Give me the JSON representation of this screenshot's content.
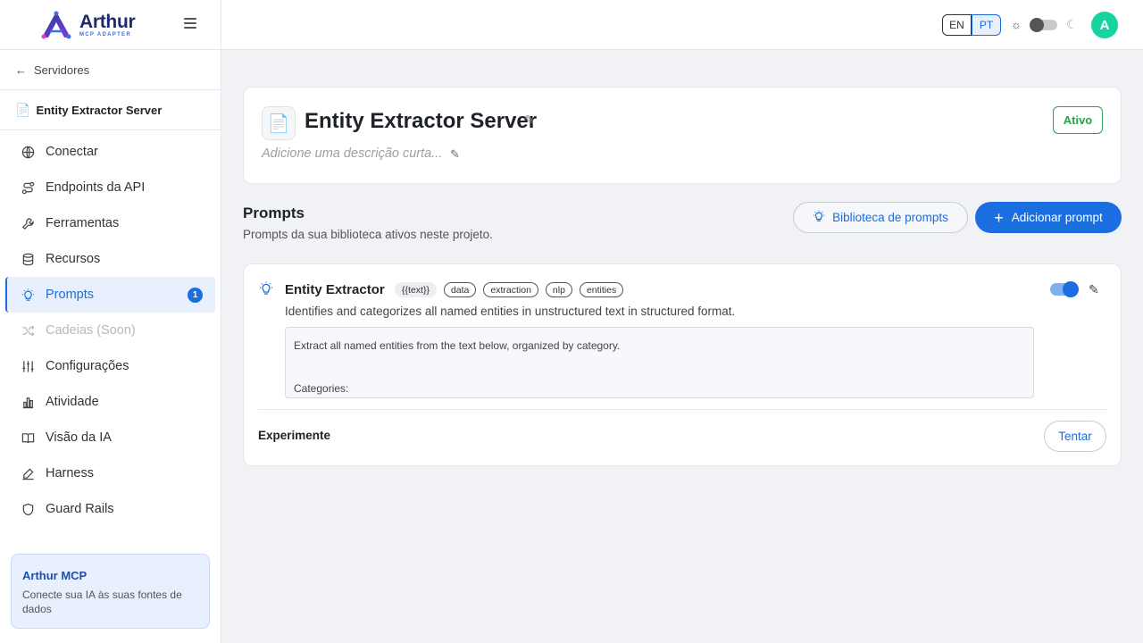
{
  "brand": {
    "title": "Arthur",
    "subtitle": "MCP ADAPTER"
  },
  "sidebar": {
    "back_label": "Servidores",
    "server_name": "Entity Extractor Server",
    "items": [
      {
        "label": "Conectar",
        "icon": "globe-icon"
      },
      {
        "label": "Endpoints da API",
        "icon": "route-icon"
      },
      {
        "label": "Ferramentas",
        "icon": "wrench-icon"
      },
      {
        "label": "Recursos",
        "icon": "database-icon"
      },
      {
        "label": "Prompts",
        "icon": "lightbulb-icon",
        "badge": "1",
        "active": true
      },
      {
        "label": "Cadeias (Soon)",
        "icon": "shuffle-icon",
        "disabled": true
      },
      {
        "label": "Configurações",
        "icon": "sliders-icon"
      },
      {
        "label": "Atividade",
        "icon": "bar-chart-icon"
      },
      {
        "label": "Visão da IA",
        "icon": "book-icon"
      },
      {
        "label": "Harness",
        "icon": "pen-tool-icon"
      },
      {
        "label": "Guard Rails",
        "icon": "shield-icon"
      }
    ],
    "promo": {
      "title": "Arthur MCP",
      "text": "Conecte sua IA às suas fontes de dados"
    }
  },
  "header": {
    "lang_en": "EN",
    "lang_pt": "PT",
    "selected_lang": "PT",
    "avatar_initial": "A",
    "avatar_color": "#16d3a0"
  },
  "server": {
    "title": "Entity Extractor Server",
    "description_placeholder": "Adicione uma descrição curta...",
    "status": "Ativo",
    "status_color": "#2e9e4f"
  },
  "prompts_section": {
    "title": "Prompts",
    "subtitle": "Prompts da sua biblioteca ativos neste projeto.",
    "library_button": "Biblioteca de prompts",
    "add_button": "Adicionar prompt"
  },
  "prompt": {
    "name": "Entity Extractor",
    "tags": [
      "{{text}}",
      "data",
      "extraction",
      "nlp",
      "entities"
    ],
    "description": "Identifies and categorizes all named entities in unstructured text in structured format.",
    "body_lines": [
      "Extract all named entities from the text below, organized by category.",
      "Categories:"
    ],
    "enabled": true,
    "try_label": "Experimente",
    "try_button": "Tentar"
  },
  "accent_color": "#1a6ee0"
}
